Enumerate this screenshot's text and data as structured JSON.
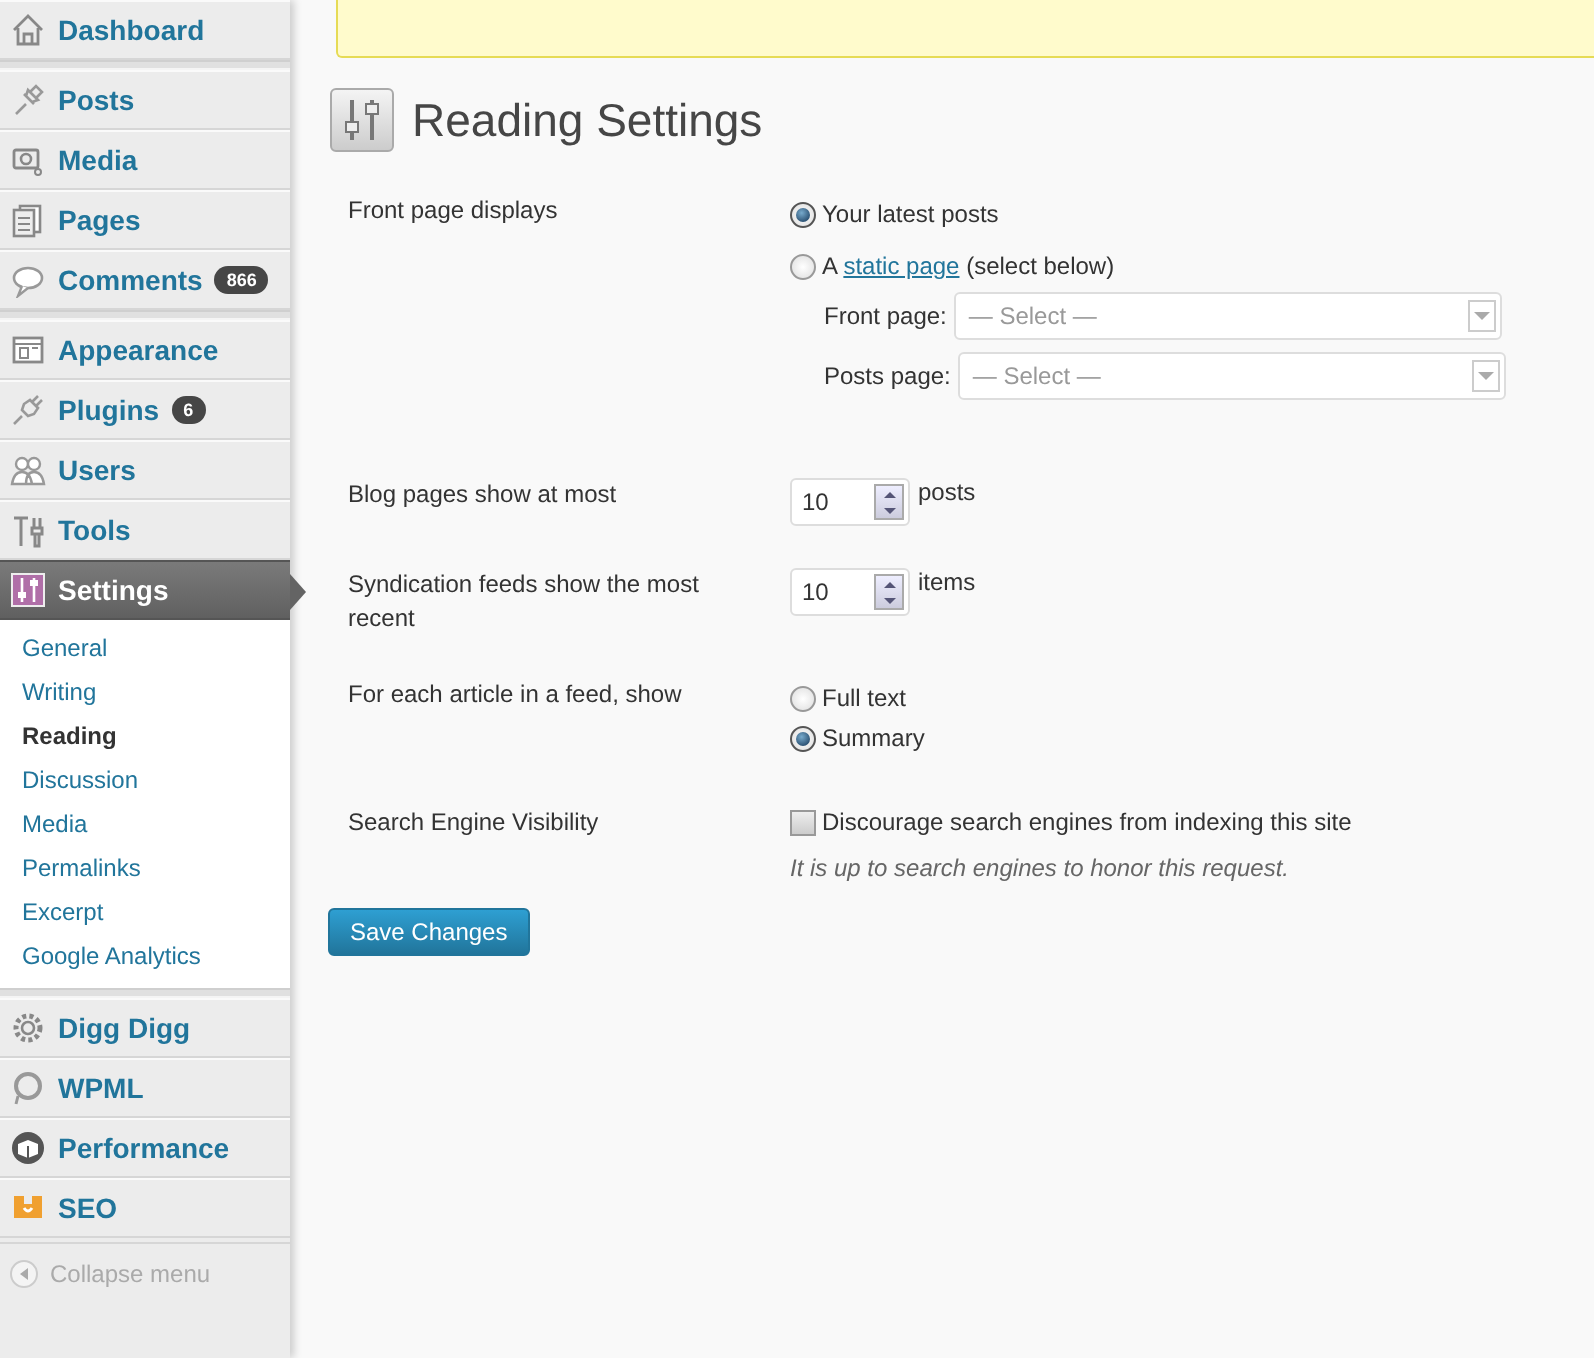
{
  "sidebar": {
    "groups": [
      [
        {
          "label": "Dashboard",
          "selected": false
        }
      ],
      [
        {
          "label": "Posts",
          "selected": false
        },
        {
          "label": "Media",
          "selected": false
        },
        {
          "label": "Pages",
          "selected": false
        },
        {
          "label": "Comments",
          "selected": false,
          "badge": "866"
        }
      ],
      [
        {
          "label": "Appearance",
          "selected": false
        },
        {
          "label": "Plugins",
          "selected": false,
          "badge": "6"
        },
        {
          "label": "Users",
          "selected": false
        },
        {
          "label": "Tools",
          "selected": false
        },
        {
          "label": "Settings",
          "selected": true,
          "children": [
            {
              "label": "General",
              "selected": false
            },
            {
              "label": "Writing",
              "selected": false
            },
            {
              "label": "Reading",
              "selected": true
            },
            {
              "label": "Discussion",
              "selected": false
            },
            {
              "label": "Media",
              "selected": false
            },
            {
              "label": "Permalinks",
              "selected": false
            },
            {
              "label": "Excerpt",
              "selected": false
            },
            {
              "label": "Google Analytics",
              "selected": false
            }
          ]
        }
      ],
      [
        {
          "label": "Digg Digg",
          "selected": false
        },
        {
          "label": "WPML",
          "selected": false
        },
        {
          "label": "Performance",
          "selected": false
        },
        {
          "label": "SEO",
          "selected": false
        }
      ]
    ],
    "collapse": "Collapse menu"
  },
  "page": {
    "title": "Reading Settings",
    "rows": [
      {
        "kind": "radio",
        "label": "Front page displays",
        "options": [
          {
            "label": "Your latest posts",
            "selected": true
          },
          {
            "text_before": "A ",
            "link": "static page",
            "text_after": " (select below)",
            "selected": false,
            "selects": [
              {
                "label": "Front page:",
                "value": "— Select —"
              },
              {
                "label": "Posts page:",
                "value": "— Select —"
              }
            ]
          }
        ]
      },
      {
        "kind": "number",
        "label": "Blog pages show at most",
        "value": "10",
        "unit": "posts"
      },
      {
        "kind": "number",
        "label": "Syndication feeds show the most recent",
        "value": "10",
        "unit": "items"
      },
      {
        "kind": "radio",
        "label": "For each article in a feed, show",
        "options": [
          {
            "label": "Full text",
            "selected": false
          },
          {
            "label": "Summary",
            "selected": true
          }
        ]
      },
      {
        "kind": "checkbox",
        "label": "Search Engine Visibility",
        "option": "Discourage search engines from indexing this site",
        "checked": false,
        "description": "It is up to search engines to honor this request."
      }
    ],
    "button": "Save Changes"
  }
}
